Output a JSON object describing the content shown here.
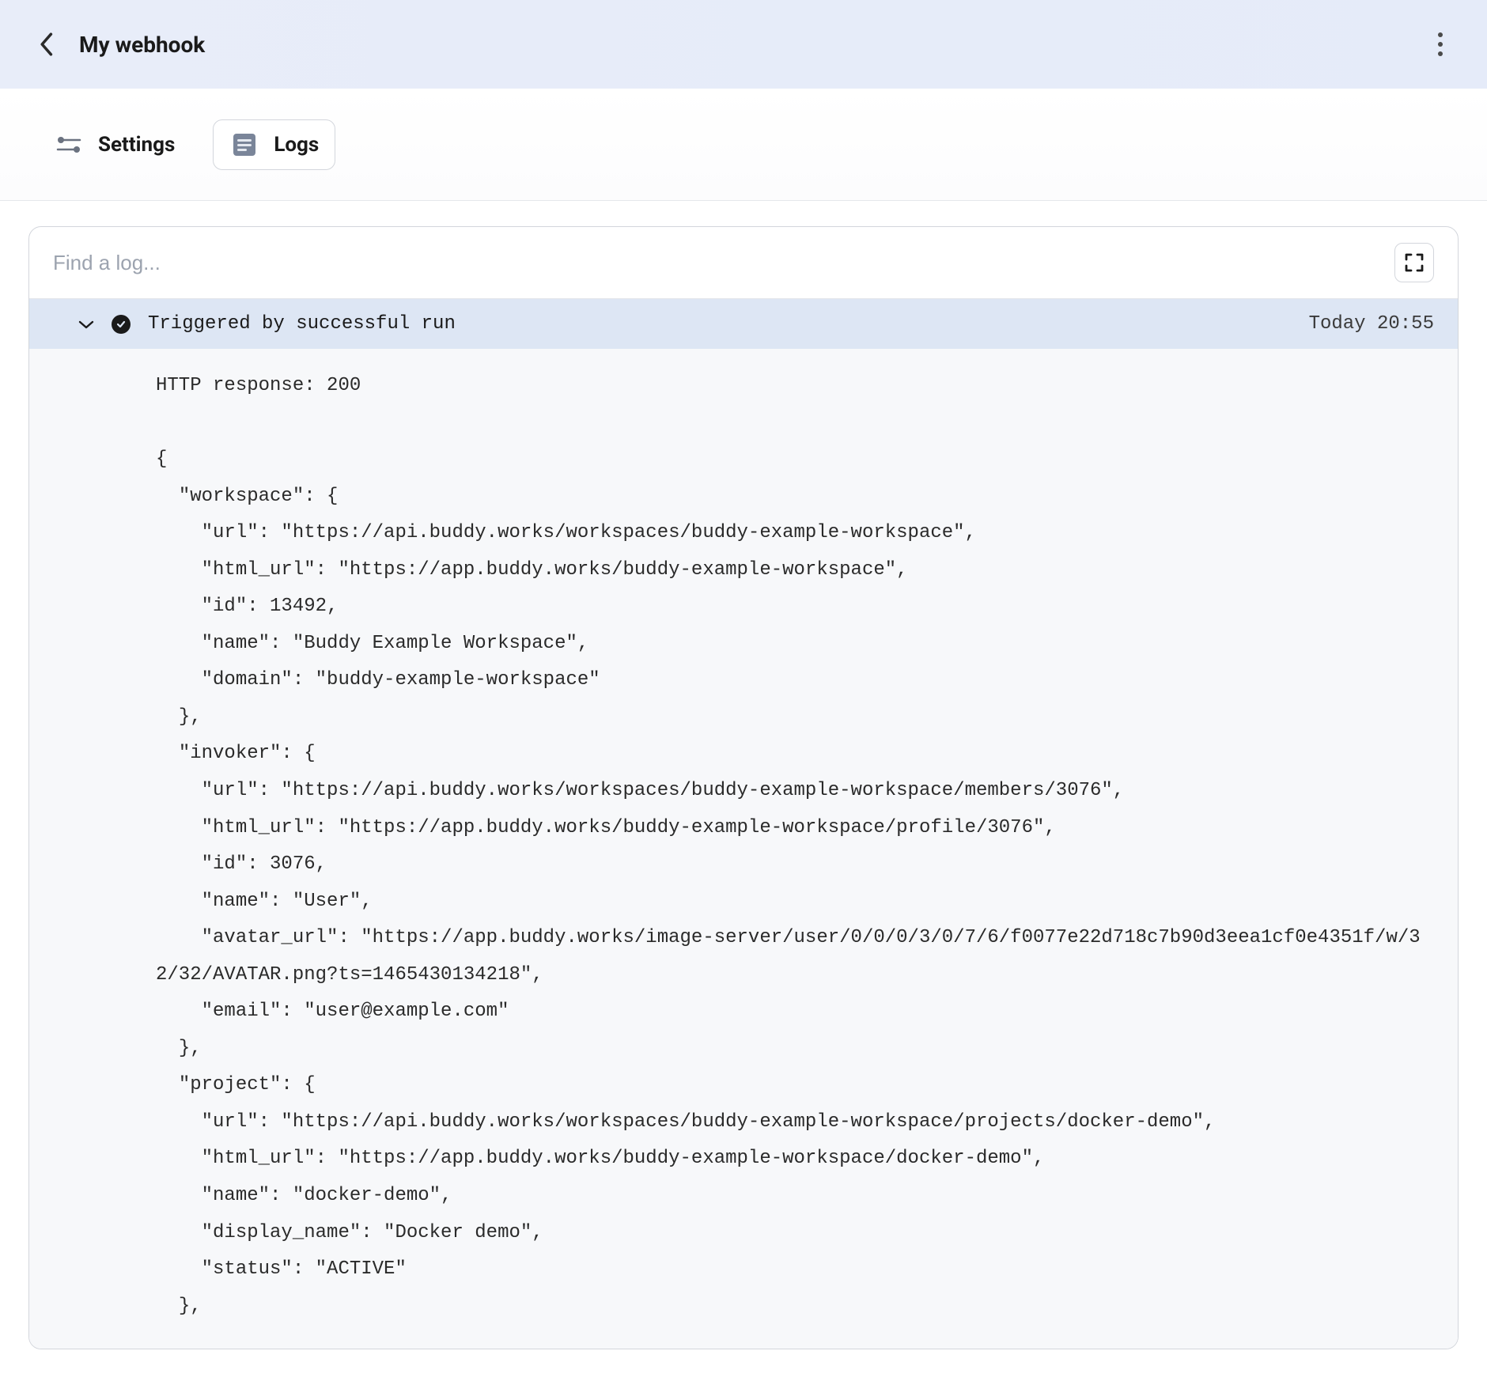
{
  "header": {
    "title": "My webhook"
  },
  "tabs": {
    "settings_label": "Settings",
    "logs_label": "Logs"
  },
  "search": {
    "placeholder": "Find a log..."
  },
  "log": {
    "trigger_text": "Triggered by successful run",
    "timestamp": "Today 20:55",
    "body": "HTTP response: 200\n\n{\n  \"workspace\": {\n    \"url\": \"https://api.buddy.works/workspaces/buddy-example-workspace\",\n    \"html_url\": \"https://app.buddy.works/buddy-example-workspace\",\n    \"id\": 13492,\n    \"name\": \"Buddy Example Workspace\",\n    \"domain\": \"buddy-example-workspace\"\n  },\n  \"invoker\": {\n    \"url\": \"https://api.buddy.works/workspaces/buddy-example-workspace/members/3076\",\n    \"html_url\": \"https://app.buddy.works/buddy-example-workspace/profile/3076\",\n    \"id\": 3076,\n    \"name\": \"User\",\n    \"avatar_url\": \"https://app.buddy.works/image-server/user/0/0/0/3/0/7/6/f0077e22d718c7b90d3eea1cf0e4351f/w/32/32/AVATAR.png?ts=1465430134218\",\n    \"email\": \"user@example.com\"\n  },\n  \"project\": {\n    \"url\": \"https://api.buddy.works/workspaces/buddy-example-workspace/projects/docker-demo\",\n    \"html_url\": \"https://app.buddy.works/buddy-example-workspace/docker-demo\",\n    \"name\": \"docker-demo\",\n    \"display_name\": \"Docker demo\",\n    \"status\": \"ACTIVE\"\n  },"
  }
}
